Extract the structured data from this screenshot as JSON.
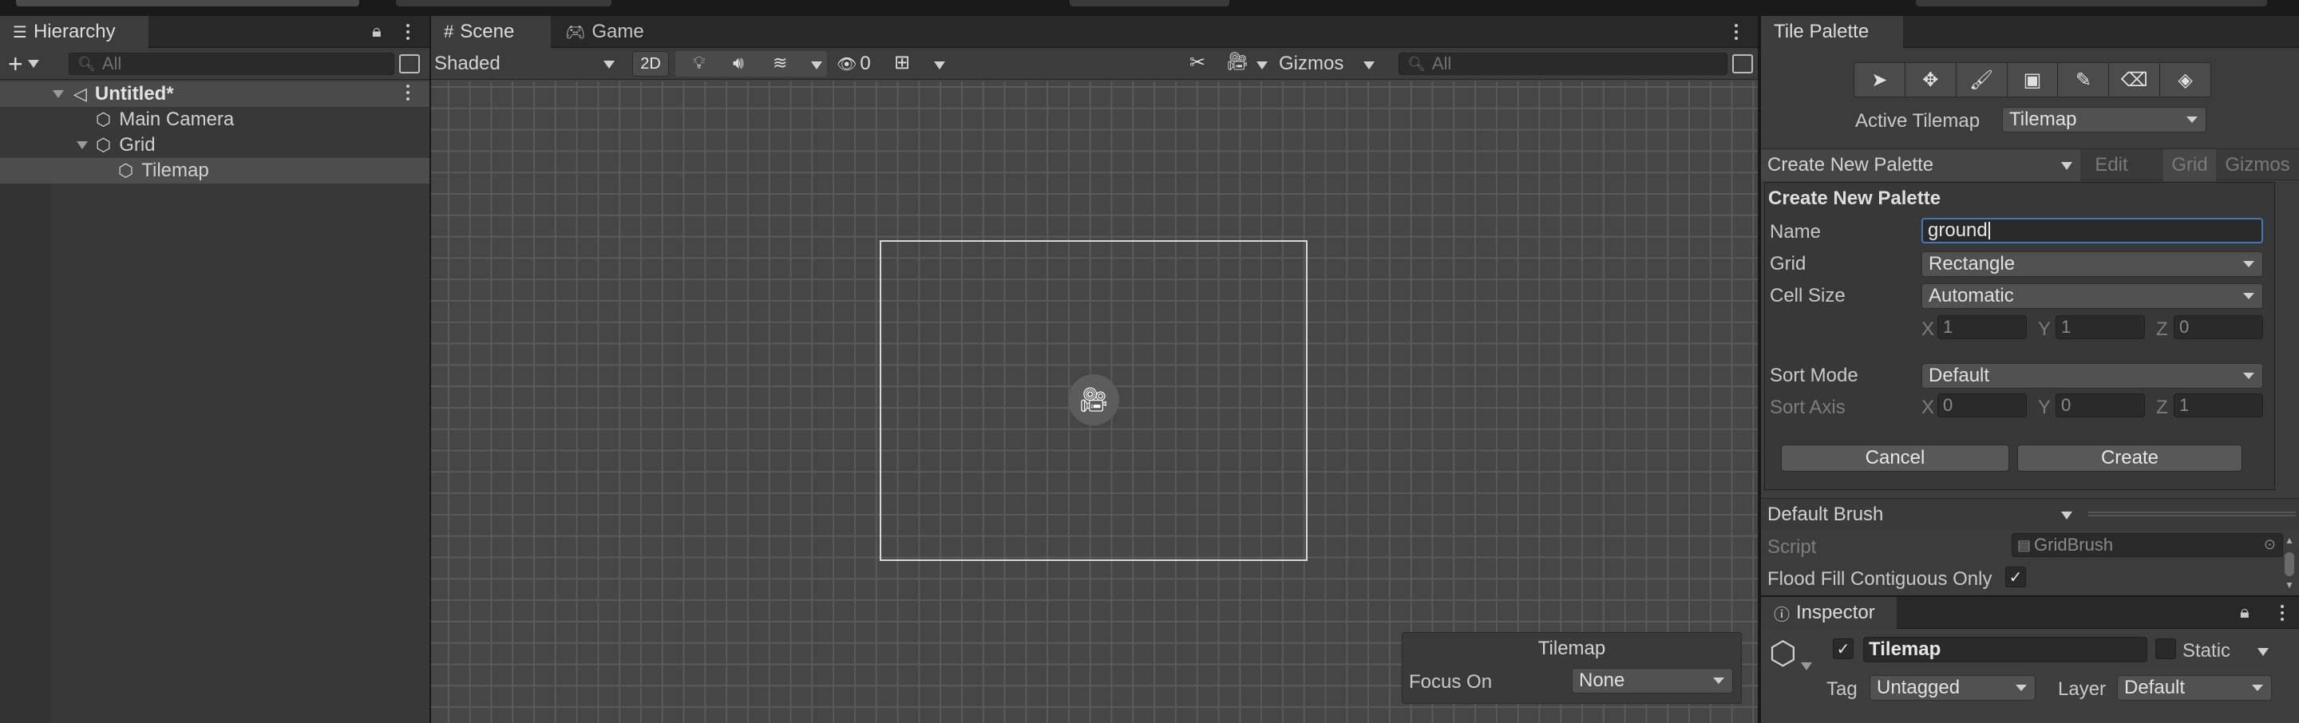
{
  "hierarchy": {
    "tab_label": "Hierarchy",
    "search_placeholder": "All",
    "add_label": "+",
    "scene_name": "Untitled*",
    "objects": [
      {
        "label": "Main Camera"
      },
      {
        "label": "Grid"
      },
      {
        "label": "Tilemap"
      }
    ]
  },
  "scene": {
    "tabs": [
      {
        "label": "Scene"
      },
      {
        "label": "Game"
      }
    ],
    "shading_mode": "Shaded",
    "mode_2d_label": "2D",
    "hidden_count": "0",
    "gizmos_label": "Gizmos",
    "search_placeholder": "All",
    "overlay": {
      "title": "Tilemap",
      "focus_label": "Focus On",
      "focus_value": "None"
    }
  },
  "tile_palette": {
    "tab_label": "Tile Palette",
    "tools": [
      "select-icon",
      "move-icon",
      "paint-brush-icon",
      "box-fill-icon",
      "picker-icon",
      "eraser-icon",
      "flood-fill-icon"
    ],
    "active_tilemap_label": "Active Tilemap",
    "active_tilemap_value": "Tilemap",
    "palette_dropdown": "Create New Palette",
    "edit_label": "Edit",
    "grid_label": "Grid",
    "gizmos_label": "Gizmos",
    "create_new_palette": {
      "title": "Create New Palette",
      "name_label": "Name",
      "name_value": "ground",
      "grid_label": "Grid",
      "grid_value": "Rectangle",
      "cell_size_label": "Cell Size",
      "cell_size_value": "Automatic",
      "cell_size_xyz": {
        "x_label": "X",
        "x": "1",
        "y_label": "Y",
        "y": "1",
        "z_label": "Z",
        "z": "0"
      },
      "sort_mode_label": "Sort Mode",
      "sort_mode_value": "Default",
      "sort_axis_label": "Sort Axis",
      "sort_axis_xyz": {
        "x_label": "X",
        "x": "0",
        "y_label": "Y",
        "y": "0",
        "z_label": "Z",
        "z": "1"
      },
      "cancel_label": "Cancel",
      "create_label": "Create"
    },
    "brush_dropdown": "Default Brush",
    "script_label": "Script",
    "script_value": "GridBrush",
    "flood_fill_label": "Flood Fill Contiguous Only",
    "flood_fill_checked": true
  },
  "inspector": {
    "tab_label": "Inspector",
    "object_name": "Tilemap",
    "active_checked": true,
    "static_label": "Static",
    "tag_label": "Tag",
    "tag_value": "Untagged",
    "layer_label": "Layer",
    "layer_value": "Default"
  },
  "colors": {
    "panel_bg": "#383838",
    "scene_bg": "#464646",
    "selection": "#4d4d4d",
    "input_focus_border": "#3a79bb"
  }
}
